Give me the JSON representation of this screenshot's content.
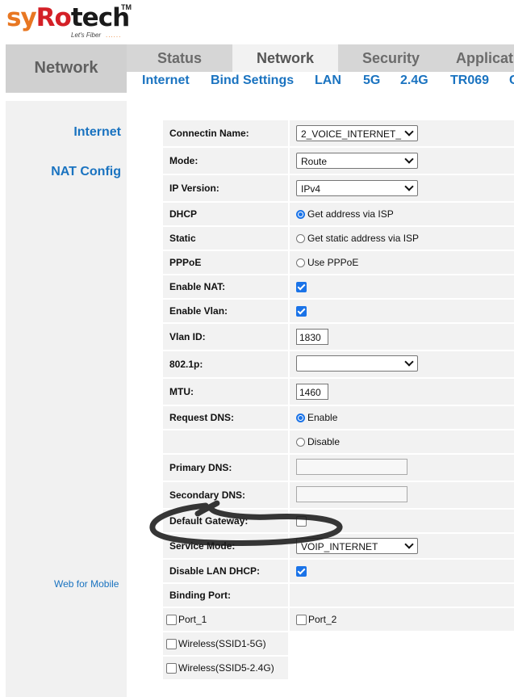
{
  "logo": {
    "part1": "sy",
    "part2": "Ro",
    "part3": "tech",
    "tm": "TM",
    "tagline": "Let's Fiber",
    "dots": "......"
  },
  "nav": {
    "brand": "Network",
    "main_tabs": [
      "Status",
      "Network",
      "Security",
      "Applicat"
    ],
    "sub_tabs": [
      "Internet",
      "Bind Settings",
      "LAN",
      "5G",
      "2.4G",
      "TR069",
      "C"
    ]
  },
  "sidebar": {
    "items": [
      "Internet",
      "NAT Config"
    ],
    "mobile_link": "Web for Mobile"
  },
  "form": {
    "connection_name": {
      "label": "Connectin Name:",
      "value": "2_VOICE_INTERNET_"
    },
    "mode": {
      "label": "Mode:",
      "value": "Route"
    },
    "ip_version": {
      "label": "IP Version:",
      "value": "IPv4"
    },
    "dhcp": {
      "label": "DHCP",
      "option": "Get address via ISP",
      "checked": true
    },
    "static": {
      "label": "Static",
      "option": "Get static address via ISP",
      "checked": false
    },
    "pppoe": {
      "label": "PPPoE",
      "option": "Use PPPoE",
      "checked": false
    },
    "enable_nat": {
      "label": "Enable NAT:",
      "checked": true
    },
    "enable_vlan": {
      "label": "Enable Vlan:",
      "checked": true
    },
    "vlan_id": {
      "label": "Vlan ID:",
      "value": "1830"
    },
    "dot1p": {
      "label": "802.1p:",
      "value": ""
    },
    "mtu": {
      "label": "MTU:",
      "value": "1460"
    },
    "request_dns": {
      "label": "Request DNS:",
      "enable": "Enable",
      "disable": "Disable",
      "selected": "Enable"
    },
    "primary_dns": {
      "label": "Primary DNS:",
      "value": ""
    },
    "secondary_dns": {
      "label": "Secondary DNS:",
      "value": ""
    },
    "default_gateway": {
      "label": "Default Gateway:",
      "checked": false
    },
    "service_mode": {
      "label": "Service Mode:",
      "value": "VOIP_INTERNET"
    },
    "disable_lan_dhcp": {
      "label": "Disable LAN DHCP:",
      "checked": true
    },
    "binding_port": {
      "label": "Binding Port:"
    },
    "ports": [
      "Port_1",
      "Port_2",
      "Wireless(SSID1-5G)",
      "Wireless(SSID5-2.4G)"
    ]
  },
  "colors": {
    "link": "#1a73c0",
    "accent": "#1a73e8",
    "panel": "#f2f2f2"
  }
}
